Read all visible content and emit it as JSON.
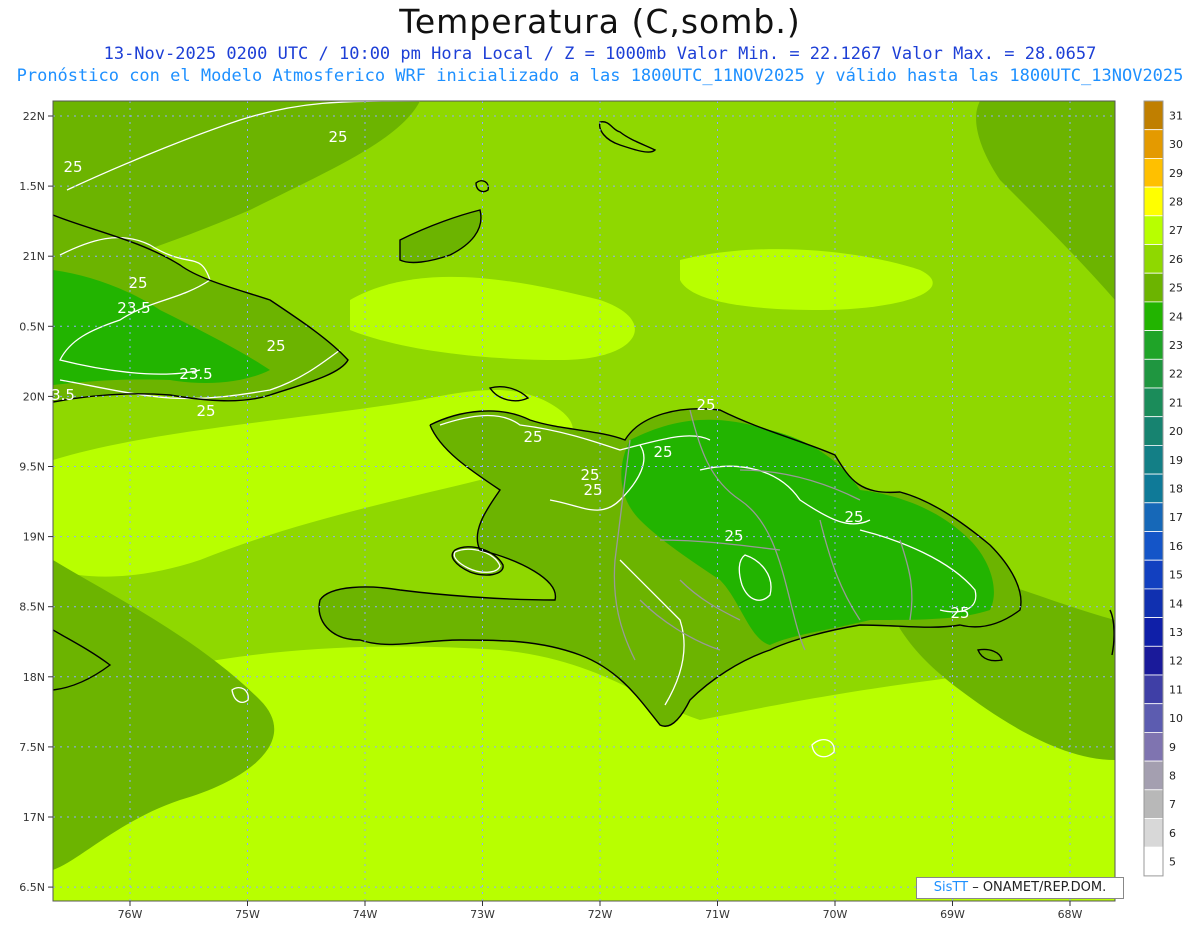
{
  "header": {
    "title": "Temperatura (C,somb.)",
    "subtitle_1": "13-Nov-2025 0200 UTC / 10:00 pm Hora Local / Z = 1000mb  Valor Min. = 22.1267  Valor Max. = 28.0657",
    "subtitle_2": "Pronóstico con el Modelo Atmosferico WRF inicializado a las 1800UTC_11NOV2025 y válido hasta las  1800UTC_13NOV2025"
  },
  "axes": {
    "lat_labels": [
      "22N",
      "1.5N",
      "21N",
      "0.5N",
      "20N",
      "9.5N",
      "19N",
      "8.5N",
      "18N",
      "7.5N",
      "17N",
      "6.5N"
    ],
    "lat_values": [
      22,
      21.5,
      21,
      20.5,
      20,
      19.5,
      19,
      18.5,
      18,
      17.5,
      17,
      16.5
    ],
    "lon_labels": [
      "76W",
      "75W",
      "74W",
      "73W",
      "72W",
      "71W",
      "70W",
      "69W",
      "68W"
    ],
    "lon_values": [
      -76,
      -75,
      -74,
      -73,
      -72,
      -71,
      -70,
      -69,
      -68
    ]
  },
  "contour_labels": [
    "25",
    "25",
    "23.5",
    "25",
    "23.5",
    "3.5",
    "25",
    "25",
    "25",
    "25",
    "25",
    "25",
    "25",
    "25",
    "25",
    "25"
  ],
  "colorbar": {
    "levels": [
      "31",
      "30",
      "29",
      "28",
      "27",
      "26",
      "25",
      "24",
      "23",
      "22",
      "21",
      "20",
      "19",
      "18",
      "17",
      "16",
      "15",
      "14",
      "13",
      "12",
      "11",
      "10",
      "9",
      "8",
      "7",
      "6",
      "5"
    ],
    "colors": [
      "#c07f00",
      "#e49a00",
      "#ffc000",
      "#ffff00",
      "#b8ff00",
      "#8fd800",
      "#6cb400",
      "#22b400",
      "#1fa428",
      "#1f9640",
      "#1b8c5a",
      "#178370",
      "#137f86",
      "#0f7a98",
      "#1668b8",
      "#1455c8",
      "#1240c0",
      "#1030b0",
      "#0f1fa8",
      "#1a1a9a",
      "#3f3fa6",
      "#5c5cb0",
      "#7f74b0",
      "#a49fb0",
      "#b8b8b8",
      "#d8d8d8",
      "#ffffff"
    ]
  },
  "credit": {
    "sis": "SisTT",
    "text": " – ONAMET/REP.DOM."
  },
  "colors": {
    "sea_base": "#8fd800",
    "sea_warm": "#b8ff00",
    "land_mid": "#6cb400",
    "land_cool": "#22b400",
    "land_cold": "#1fa428",
    "coast": "#000000",
    "border": "#999999",
    "contour": "#ffffff",
    "grid": "#8fa8ff"
  }
}
